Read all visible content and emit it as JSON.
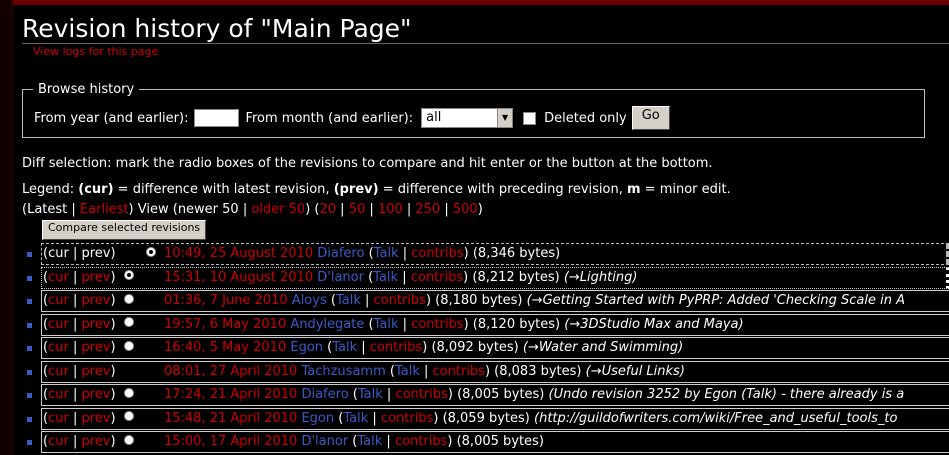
{
  "page": {
    "title": "Revision history of \"Main Page\"",
    "view_logs": "View logs for this page"
  },
  "browse": {
    "legend": "Browse history",
    "year_label": "From year (and earlier):",
    "year_value": "",
    "month_label": "From month (and earlier):",
    "month_value": "all",
    "deleted_label": "Deleted only",
    "go_label": "Go"
  },
  "info": {
    "diff_text": "Diff selection: mark the radio boxes of the revisions to compare and hit enter or the button at the bottom.",
    "legend_prefix": "Legend: ",
    "legend_cur": "(cur)",
    "legend_mid1": " = difference with latest revision, ",
    "legend_prev": "(prev)",
    "legend_mid2": " = difference with preceding revision, ",
    "legend_m": "m",
    "legend_end": " = minor edit."
  },
  "nav": {
    "open": "(",
    "latest": "Latest",
    "sep": " | ",
    "earliest": "Earliest",
    "view": ") View (",
    "newer": "newer 50",
    "older": "older 50",
    "close_open": ") (",
    "limits": [
      "20",
      "50",
      "100",
      "250",
      "500"
    ],
    "close": ")"
  },
  "compare_button": "Compare selected revisions",
  "revisions": [
    {
      "cur": "cur",
      "prev": "prev",
      "date": "10:49, 25 August 2010",
      "user": "Diafero",
      "talk": "Talk",
      "contribs": "contribs",
      "size": "(8,346 bytes)",
      "summary": ""
    },
    {
      "cur": "cur",
      "prev": "prev",
      "date": "15:31, 10 August 2010",
      "user": "D'lanor",
      "talk": "Talk",
      "contribs": "contribs",
      "size": "(8,212 bytes)",
      "summary": "(→Lighting)"
    },
    {
      "cur": "cur",
      "prev": "prev",
      "date": "01:36, 7 June 2010",
      "user": "Aloys",
      "talk": "Talk",
      "contribs": "contribs",
      "size": "(8,180 bytes)",
      "summary": "(→Getting Started with PyPRP: Added 'Checking Scale in A"
    },
    {
      "cur": "cur",
      "prev": "prev",
      "date": "19:57, 6 May 2010",
      "user": "Andylegate",
      "talk": "Talk",
      "contribs": "contribs",
      "size": "(8,120 bytes)",
      "summary": "(→3DStudio Max and Maya)"
    },
    {
      "cur": "cur",
      "prev": "prev",
      "date": "16:40, 5 May 2010",
      "user": "Egon",
      "talk": "Talk",
      "contribs": "contribs",
      "size": "(8,092 bytes)",
      "summary": "(→Water and Swimming)"
    },
    {
      "cur": "cur",
      "prev": "prev",
      "date": "08:01, 27 April 2010",
      "user": "Tachzusamm",
      "talk": "Talk",
      "contribs": "contribs",
      "size": "(8,083 bytes)",
      "summary": "(→Useful Links)"
    },
    {
      "cur": "cur",
      "prev": "prev",
      "date": "17:24, 21 April 2010",
      "user": "Diafero",
      "talk": "Talk",
      "contribs": "contribs",
      "size": "(8,005 bytes)",
      "summary": "(Undo revision 3252 by Egon (Talk) - there already is a"
    },
    {
      "cur": "cur",
      "prev": "prev",
      "date": "15:48, 21 April 2010",
      "user": "Egon",
      "talk": "Talk",
      "contribs": "contribs",
      "size": "(8,059 bytes)",
      "summary": "(http://guildofwriters.com/wiki/Free_and_useful_tools_to"
    },
    {
      "cur": "cur",
      "prev": "prev",
      "date": "15:00, 17 April 2010",
      "user": "D'lanor",
      "talk": "Talk",
      "contribs": "contribs",
      "size": "(8,005 bytes)",
      "summary": ""
    }
  ]
}
